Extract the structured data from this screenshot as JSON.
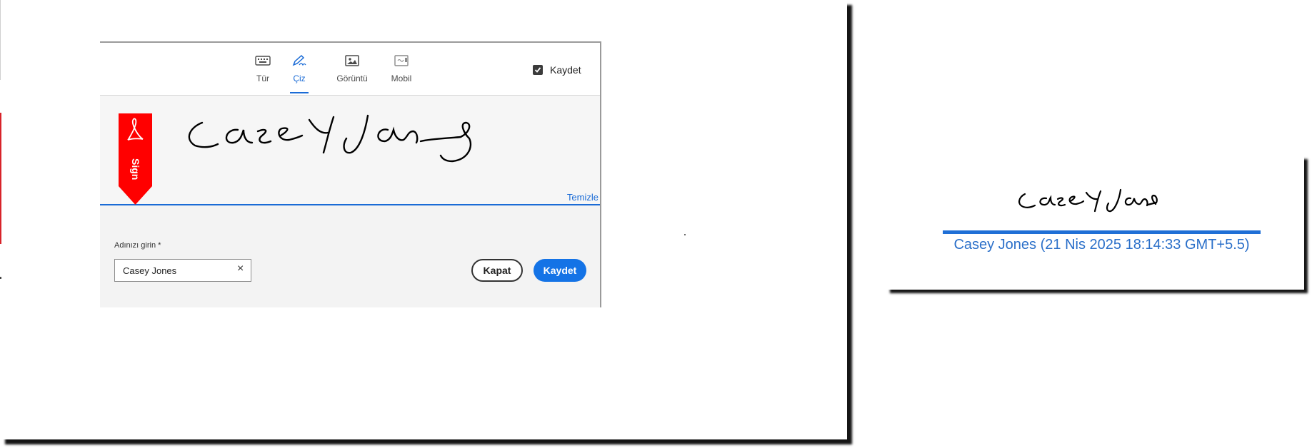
{
  "dialog": {
    "tabs": [
      {
        "label": "Tür",
        "icon": "keyboard-icon",
        "active": false
      },
      {
        "label": "Çiz",
        "icon": "pen-icon",
        "active": true
      },
      {
        "label": "Görüntü",
        "icon": "image-icon",
        "active": false
      },
      {
        "label": "Mobil",
        "icon": "mobile-icon",
        "active": false
      }
    ],
    "save_checkbox": {
      "label": "Kaydet",
      "checked": true
    },
    "sign_flag_text": "Sign",
    "clear_label": "Temizle",
    "name_label": "Adınızı girin",
    "required_mark": "*",
    "name_value": "Casey Jones",
    "close_button": "Kapat",
    "save_button": "Kaydet"
  },
  "preview": {
    "caption": "Casey Jones (21 Nis 2025 18:14:33 GMT+5.5)"
  },
  "colors": {
    "accent": "#1473e6",
    "sign_flag": "#ff0000",
    "caption": "#2a6fc9"
  }
}
